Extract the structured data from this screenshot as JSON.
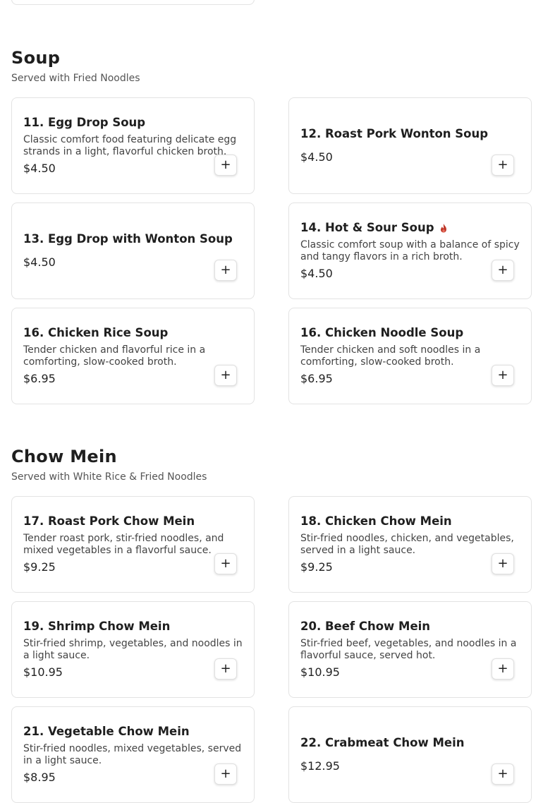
{
  "colors": {
    "spicy": "#c0392b",
    "card_border": "#e3e3e3"
  },
  "icons": {
    "add": "plus-icon",
    "spicy": "flame-icon"
  },
  "sections": [
    {
      "title": "Soup",
      "subtitle": "Served with Fried Noodles",
      "items": [
        {
          "name": "11. Egg Drop Soup",
          "description": "Classic comfort food featuring delicate egg strands in a light, flavorful chicken broth.",
          "price": "$4.50",
          "spicy": false
        },
        {
          "name": "12. Roast Pork Wonton Soup",
          "description": "",
          "price": "$4.50",
          "spicy": false
        },
        {
          "name": "13. Egg Drop with Wonton Soup",
          "description": "",
          "price": "$4.50",
          "spicy": false
        },
        {
          "name": "14. Hot & Sour Soup",
          "description": "Classic comfort soup with a balance of spicy and tangy flavors in a rich broth.",
          "price": "$4.50",
          "spicy": true
        },
        {
          "name": "16. Chicken Rice Soup",
          "description": "Tender chicken and flavorful rice in a comforting, slow-cooked broth.",
          "price": "$6.95",
          "spicy": false
        },
        {
          "name": "16. Chicken Noodle Soup",
          "description": "Tender chicken and soft noodles in a comforting, slow-cooked broth.",
          "price": "$6.95",
          "spicy": false
        }
      ]
    },
    {
      "title": "Chow Mein",
      "subtitle": "Served with White Rice & Fried Noodles",
      "items": [
        {
          "name": "17. Roast Pork Chow Mein",
          "description": "Tender roast pork, stir-fried noodles, and mixed vegetables in a flavorful sauce.",
          "price": "$9.25",
          "spicy": false
        },
        {
          "name": "18. Chicken Chow Mein",
          "description": "Stir-fried noodles, chicken, and vegetables, served in a light sauce.",
          "price": "$9.25",
          "spicy": false
        },
        {
          "name": "19. Shrimp Chow Mein",
          "description": "Stir-fried shrimp, vegetables, and noodles in a light sauce.",
          "price": "$10.95",
          "spicy": false
        },
        {
          "name": "20. Beef Chow Mein",
          "description": "Stir-fried beef, vegetables, and noodles in a flavorful sauce, served hot.",
          "price": "$10.95",
          "spicy": false
        },
        {
          "name": "21. Vegetable Chow Mein",
          "description": "Stir-fried noodles, mixed vegetables, served in a light sauce.",
          "price": "$8.95",
          "spicy": false
        },
        {
          "name": "22. Crabmeat Chow Mein",
          "description": "",
          "price": "$12.95",
          "spicy": false
        }
      ]
    }
  ]
}
